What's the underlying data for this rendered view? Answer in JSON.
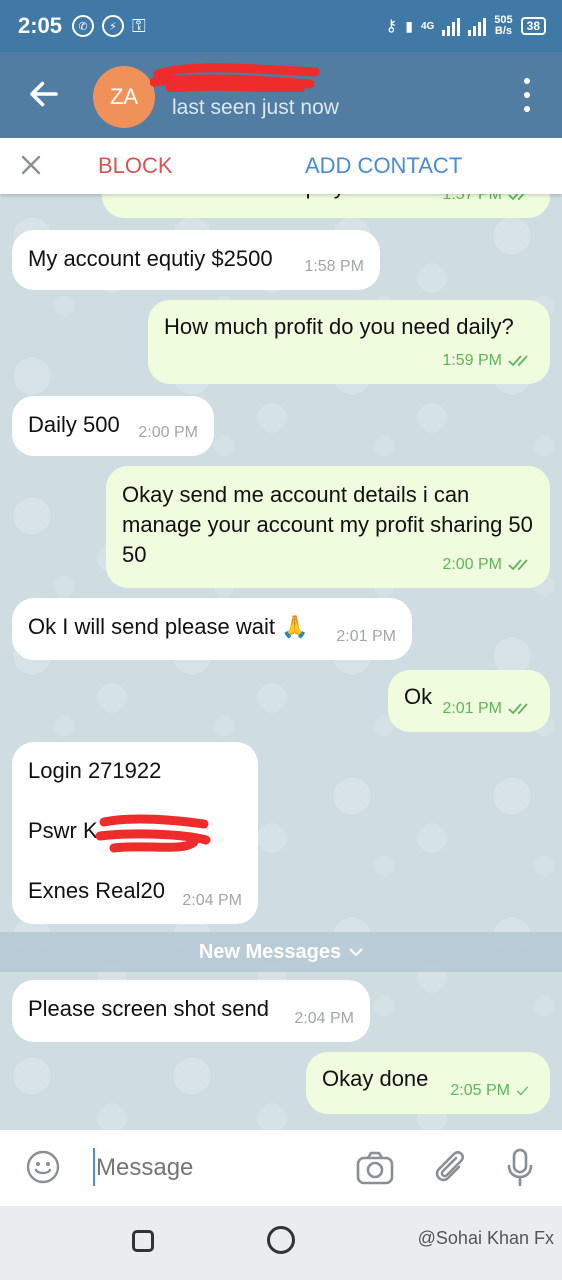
{
  "status_bar": {
    "time": "2:05",
    "network": "4G",
    "net_speed_value": "505",
    "net_speed_unit": "B/s",
    "battery": "38"
  },
  "header": {
    "avatar_initials": "ZA",
    "last_seen": "last seen just now"
  },
  "action_bar": {
    "block_label": "BLOCK",
    "add_contact_label": "ADD CONTACT"
  },
  "messages": [
    {
      "dir": "out",
      "text": "Yes How much equity account",
      "time": "1:57 PM"
    },
    {
      "dir": "in",
      "text": "My account equtiy $2500",
      "time": "1:58 PM"
    },
    {
      "dir": "out",
      "text": "How much profit do you need daily?",
      "time": "1:59 PM"
    },
    {
      "dir": "in",
      "text": "Daily 500",
      "time": "2:00 PM"
    },
    {
      "dir": "out",
      "text": "Okay send me account details i can manage your account my profit sharing 50 50",
      "time": "2:00 PM"
    },
    {
      "dir": "in",
      "text": "Ok I will send please wait 🙏",
      "time": "2:01 PM"
    },
    {
      "dir": "out",
      "text": "Ok",
      "time": "2:01 PM"
    },
    {
      "dir": "in",
      "line1": "Login 271922",
      "line2": "Pswr K",
      "line3": "Exnes Real20",
      "time": "2:04 PM"
    },
    {
      "dir": "in",
      "text": "Please screen shot send",
      "time": "2:04 PM"
    },
    {
      "dir": "out",
      "text": "Okay done",
      "time": "2:05 PM"
    }
  ],
  "new_messages_label": "New Messages",
  "input": {
    "placeholder": "Message"
  },
  "watermark": "@Sohai Khan Fx",
  "colors": {
    "header": "#517da2",
    "status_bar": "#4179a6",
    "block": "#d65457",
    "add_contact": "#4b8bd1",
    "outgoing_bubble": "#effdde",
    "incoming_bubble": "#ffffff",
    "tick_green": "#5fb45a"
  },
  "icons": [
    "back-arrow-icon",
    "more-vert-icon",
    "close-icon",
    "emoji-icon",
    "camera-icon",
    "attach-icon",
    "mic-icon",
    "double-check-icon",
    "single-check-icon",
    "chevron-down-icon"
  ]
}
